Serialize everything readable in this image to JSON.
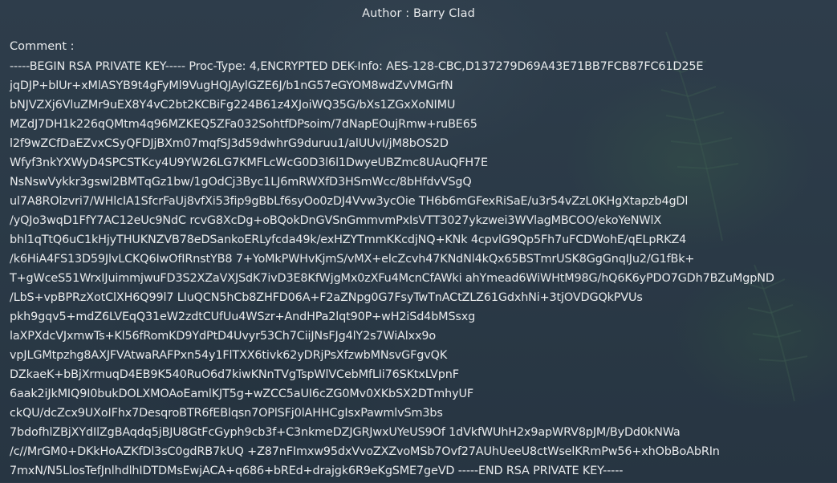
{
  "author": {
    "prefix": "Author : ",
    "name": "Barry Clad"
  },
  "comment": {
    "label": "Comment :",
    "lines": [
      "-----BEGIN RSA PRIVATE KEY----- Proc-Type: 4,ENCRYPTED DEK-Info: AES-128-CBC,D137279D69A43E71BB7FCB87FC61D25E",
      "jqDJP+blUr+xMlASYB9t4gFyMl9VugHQJAylGZE6J/b1nG57eGYOM8wdZvVMGrfN",
      "bNJVZXj6VluZMr9uEX8Y4vC2bt2KCBiFg224B61z4XJoiWQ35G/bXs1ZGxXoNIMU",
      "MZdJ7DH1k226qQMtm4q96MZKEQ5ZFa032SohtfDPsoim/7dNapEOujRmw+ruBE65",
      "l2f9wZCfDaEZvxCSyQFDJjBXm07mqfSJ3d59dwhrG9duruu1/alUUvI/jM8bOS2D",
      "Wfyf3nkYXWyD4SPCSTKcy4U9YW26LG7KMFLcWcG0D3l6l1DwyeUBZmc8UAuQFH7E",
      "NsNswVykkr3gswl2BMTqGz1bw/1gOdCj3Byc1LJ6mRWXfD3HSmWcc/8bHfdvVSgQ",
      "ul7A8ROlzvri7/WHlcIA1SfcrFaUj8vfXi53fip9gBbLf6syOo0zDJ4Vvw3ycOie TH6b6mGFexRiSaE/u3r54vZzL0KHgXtapzb4gDl",
      "/yQJo3wqD1FfY7AC12eUc9NdC rcvG8XcDg+oBQokDnGVSnGmmvmPxIsVTT3027ykzwei3WVlagMBCOO/ekoYeNWlX",
      "bhl1qTtQ6uC1kHjyTHUKNZVB78eDSankoERLyfcda49k/exHZYTmmKKcdjNQ+KNk 4cpvlG9Qp5Fh7uFCDWohE/qELpRKZ4",
      "/k6HiA4FS13D59JlvLCKQ6IwOfIRnstYB8 7+YoMkPWHvKjmS/vMX+elcZcvh47KNdNl4kQx65BSTmrUSK8GgGnqIJu2/G1fBk+",
      "T+gWceS51WrxIJuimmjwuFD3S2XZaVXJSdK7ivD3E8KfWjgMx0zXFu4McnCfAWki ahYmead6WiWHtM98G/hQ6K6yPDO7GDh7BZuMgpND",
      "/LbS+vpBPRzXotClXH6Q99l7 LIuQCN5hCb8ZHFD06A+F2aZNpg0G7FsyTwTnACtZLZ61GdxhNi+3tjOVDGQkPVUs",
      "pkh9gqv5+mdZ6LVEqQ31eW2zdtCUfUu4WSzr+AndHPa2lqt90P+wH2iSd4bMSsxg",
      "laXPXdcVJxmwTs+Kl56fRomKD9YdPtD4Uvyr53Ch7CiiJNsFJg4lY2s7WiAlxx9o",
      "vpJLGMtpzhg8AXJFVAtwaRAFPxn54y1FlTXX6tivk62yDRjPsXfzwbMNsvGFgvQK",
      "DZkaeK+bBjXrmuqD4EB9K540RuO6d7kiwKNnTVgTspWlVCebMfLIi76SKtxLVpnF",
      "6aak2iJkMIQ9I0bukDOLXMOAoEamlKJT5g+wZCC5aUI6cZG0Mv0XKbSX2DTmhyUF",
      "ckQU/dcZcx9UXoIFhx7DesqroBTR6fEBlqsn7OPlSFj0lAHHCgIsxPawmlvSm3bs",
      "7bdofhlZBjXYdIlZgBAqdq5jBJU8GtFcGyph9cb3f+C3nkmeDZJGRJwxUYeUS9Of 1dVkfWUhH2x9apWRV8pJM/ByDd0kNWa",
      "/c//MrGM0+DKkHoAZKfDl3sC0gdRB7kUQ +Z87nFImxw95dxVvoZXZvoMSb7Ovf27AUhUeeU8ctWselKRmPw56+xhObBoAbRIn",
      "7mxN/N5LlosTefJnlhdlhIDTDMsEwjACA+q686+bREd+drajgk6R9eKgSME7geVD -----END RSA PRIVATE KEY-----"
    ]
  }
}
